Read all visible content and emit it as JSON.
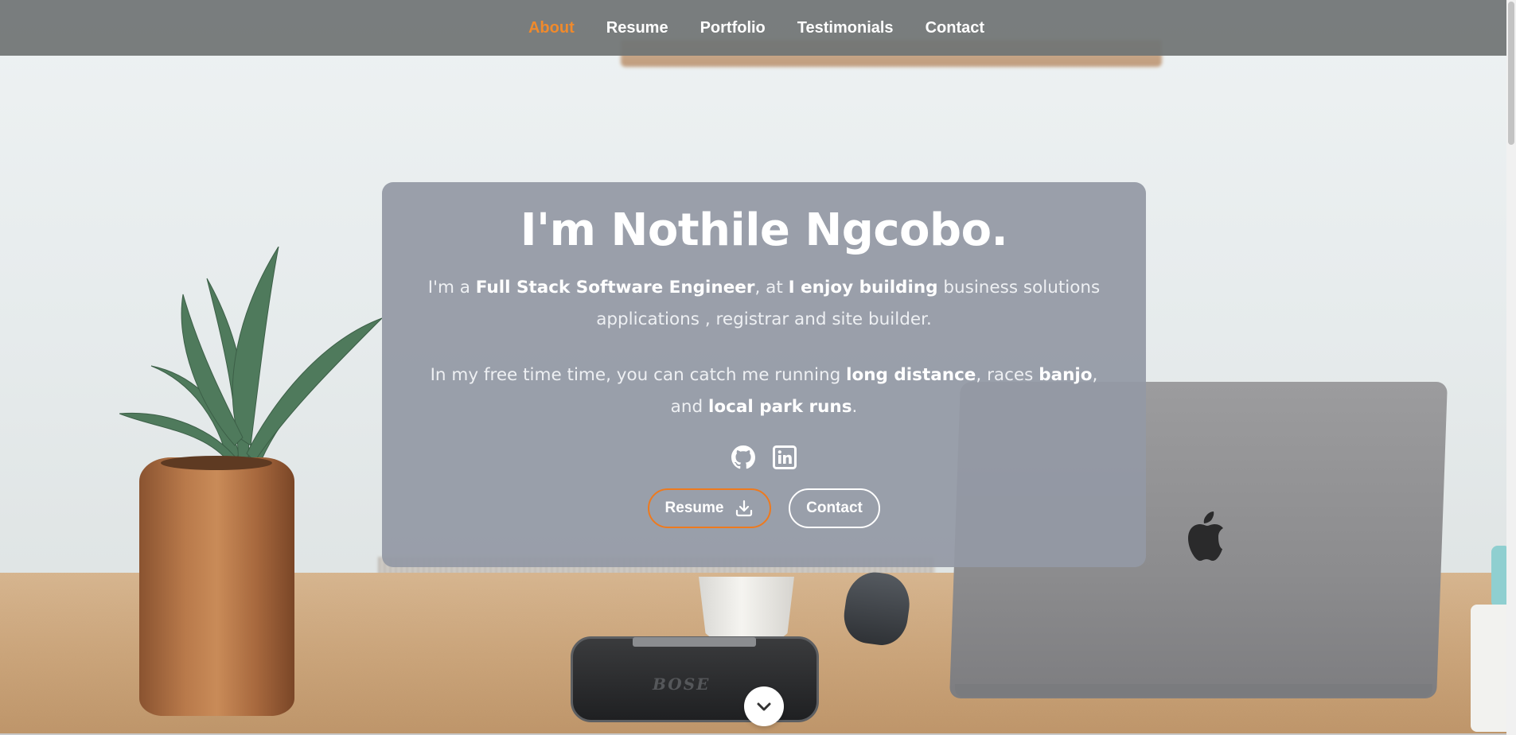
{
  "nav": {
    "items": [
      {
        "label": "About",
        "active": true
      },
      {
        "label": "Resume",
        "active": false
      },
      {
        "label": "Portfolio",
        "active": false
      },
      {
        "label": "Testimonials",
        "active": false
      },
      {
        "label": "Contact",
        "active": false
      }
    ]
  },
  "hero": {
    "title": "I'm Nothile Ngcobo.",
    "intro": {
      "t1": "I'm a ",
      "b1": "Full Stack Software Engineer",
      "t2": ", at ",
      "b2": "I enjoy building",
      "t3": " business solutions applications , registrar and site builder."
    },
    "hobbies": {
      "t1": "In my free time time, you can catch me running ",
      "b1": "long distance",
      "t2": ", races ",
      "b2": "banjo",
      "t3": ", and ",
      "b3": "local park runs",
      "t4": "."
    },
    "social": [
      "github-icon",
      "linkedin-icon"
    ],
    "buttons": {
      "resume_label": "Resume",
      "contact_label": "Contact"
    }
  },
  "background": {
    "speaker_brand": "BOSE"
  },
  "colors": {
    "accent": "#f08a2c",
    "resume_border": "#ee7a1e",
    "card": "#9399a5",
    "nav": "#707474"
  }
}
